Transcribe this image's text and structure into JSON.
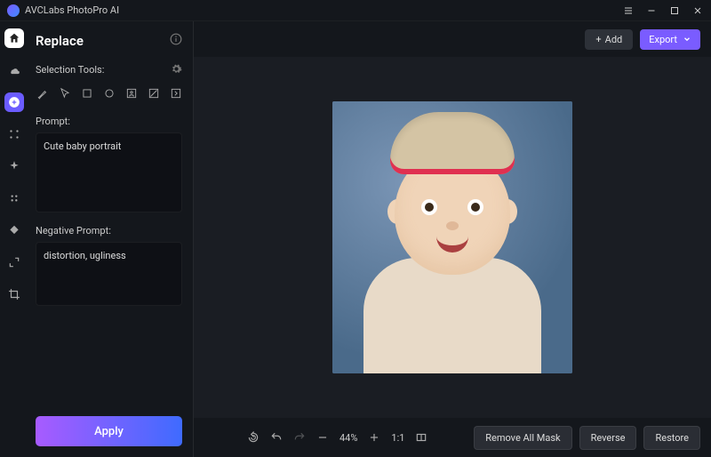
{
  "app": {
    "title": "AVCLabs PhotoPro AI"
  },
  "panel": {
    "title": "Replace",
    "selection_label": "Selection Tools:",
    "prompt_label": "Prompt:",
    "prompt_value": "Cute baby portrait",
    "neg_label": "Negative Prompt:",
    "neg_value": "distortion, ugliness",
    "apply": "Apply"
  },
  "top": {
    "add": "Add",
    "export": "Export"
  },
  "bottom": {
    "zoom": "44%",
    "ratio": "1:1",
    "remove_mask": "Remove All Mask",
    "reverse": "Reverse",
    "restore": "Restore"
  }
}
